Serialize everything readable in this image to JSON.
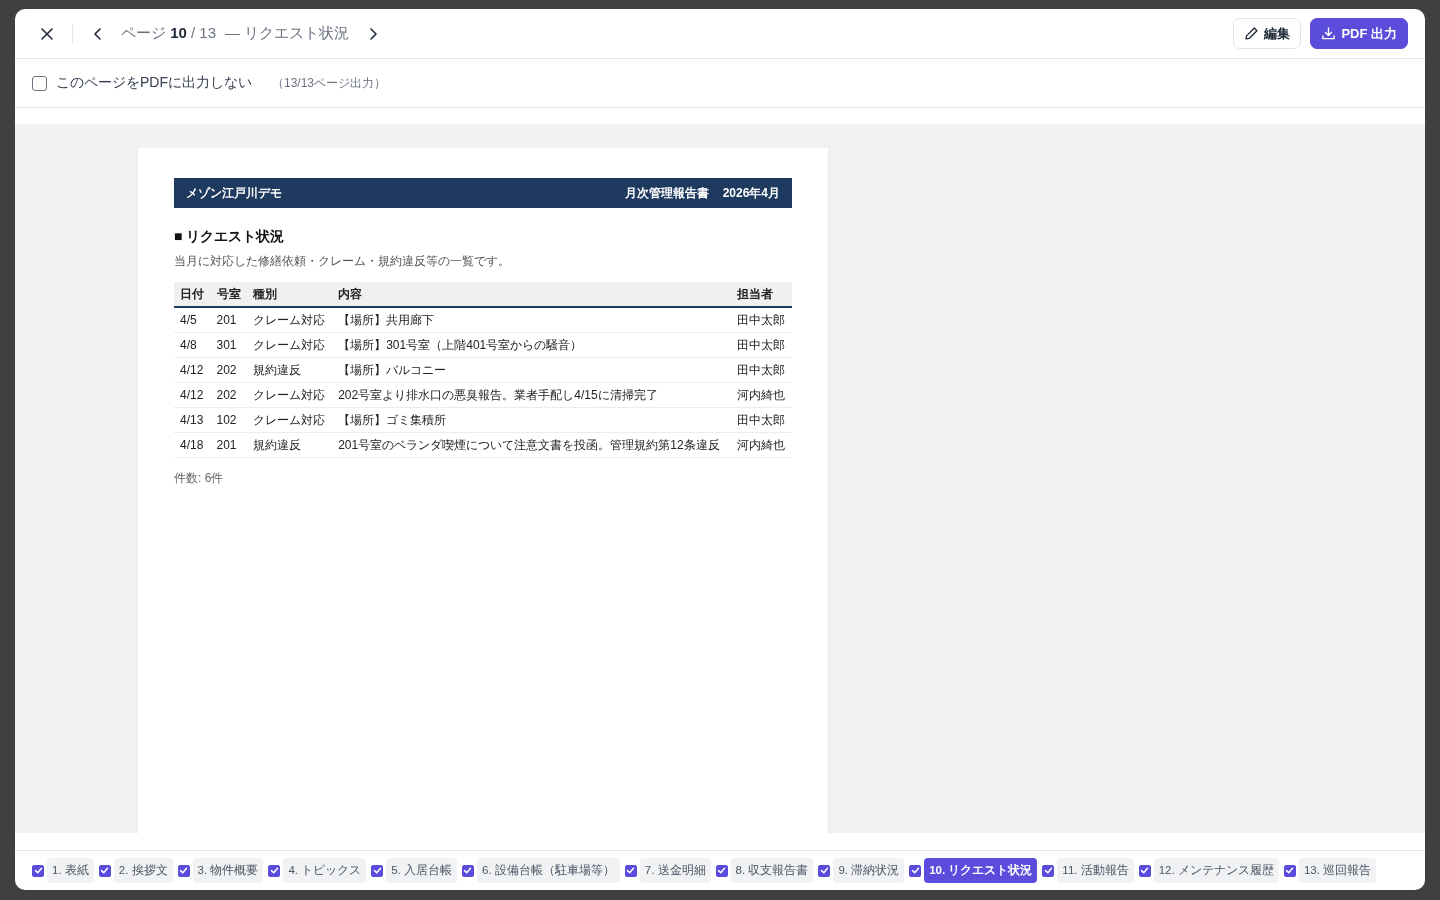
{
  "header": {
    "page_label": "ページ **10** / 13",
    "title": "— リクエスト状況",
    "buttons": [
      {
        "label": "編集",
        "kind": "secondary"
      },
      {
        "label": "PDF 出力",
        "kind": "primary"
      }
    ]
  },
  "exclude_option": {
    "label": "このページをPDFに出力しない",
    "checked": false,
    "note": "（13/13ページ出力）"
  },
  "document": {
    "building": "メゾン江戸川デモ",
    "report_title": "月次管理報告書",
    "period": "2026年4月",
    "section_title": "■ リクエスト状況",
    "description": "当月に対応した修繕依頼・クレーム・規約違反等の一覧です。",
    "table": {
      "columns": [
        "日付",
        "号室",
        "種別",
        "内容",
        "担当者"
      ],
      "rows": [
        [
          "4/5",
          "201",
          "クレーム対応",
          "【場所】共用廊下",
          "田中太郎"
        ],
        [
          "4/8",
          "301",
          "クレーム対応",
          "【場所】301号室（上階401号室からの騒音）",
          "田中太郎"
        ],
        [
          "4/12",
          "202",
          "規約違反",
          "【場所】バルコニー",
          "田中太郎"
        ],
        [
          "4/12",
          "202",
          "クレーム対応",
          "202号室より排水口の悪臭報告。業者手配し4/15に清掃完了",
          "河内綺也"
        ],
        [
          "4/13",
          "102",
          "クレーム対応",
          "【場所】ゴミ集積所",
          "田中太郎"
        ],
        [
          "4/18",
          "201",
          "規約違反",
          "201号室のベランダ喫煙について注意文書を投函。管理規約第12条違反",
          "河内綺也"
        ]
      ]
    },
    "count": "件数: 6件"
  },
  "tabs": [
    {
      "label": "1. 表紙",
      "checked": true,
      "selected": false
    },
    {
      "label": "2. 挨拶文",
      "checked": true,
      "selected": false
    },
    {
      "label": "3. 物件概要",
      "checked": true,
      "selected": false
    },
    {
      "label": "4. トピックス",
      "checked": true,
      "selected": false
    },
    {
      "label": "5. 入居台帳",
      "checked": true,
      "selected": false
    },
    {
      "label": "6. 設備台帳（駐車場等）",
      "checked": true,
      "selected": false
    },
    {
      "label": "7. 送金明細",
      "checked": true,
      "selected": false
    },
    {
      "label": "8. 収支報告書",
      "checked": true,
      "selected": false
    },
    {
      "label": "9. 滞納状況",
      "checked": true,
      "selected": false
    },
    {
      "label": "10. リクエスト状況",
      "checked": true,
      "selected": true
    },
    {
      "label": "11. 活動報告",
      "checked": true,
      "selected": false
    },
    {
      "label": "12. メンテナンス履歴",
      "checked": true,
      "selected": false
    },
    {
      "label": "13. 巡回報告",
      "checked": true,
      "selected": false
    }
  ]
}
